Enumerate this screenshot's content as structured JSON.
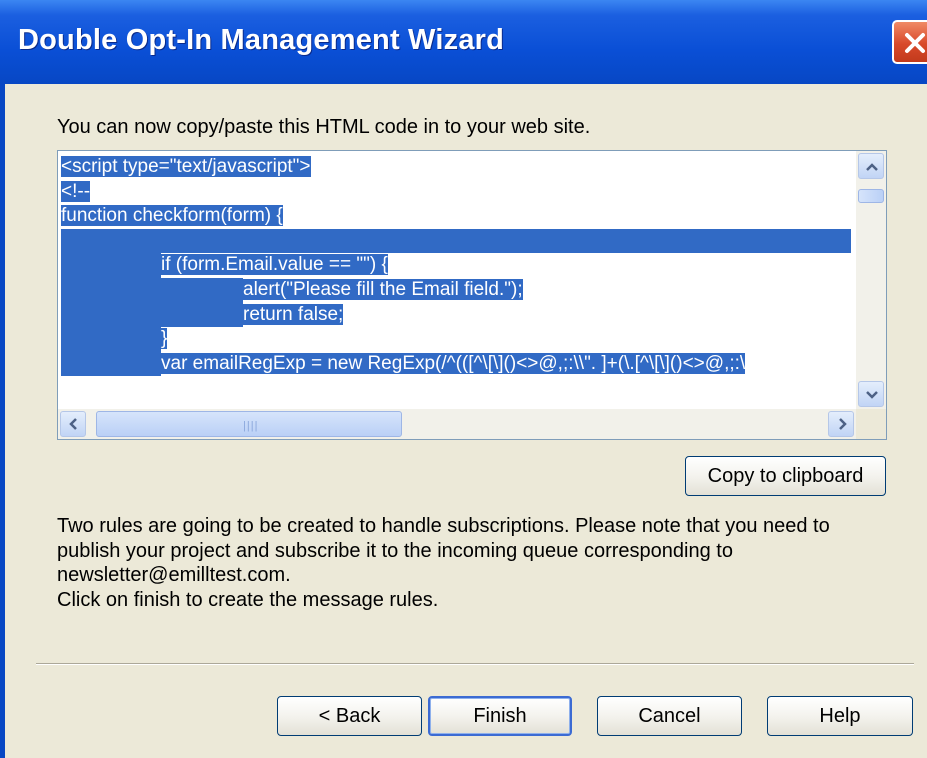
{
  "window": {
    "title": "Double Opt-In Management Wizard"
  },
  "intro_text": "You can now copy/paste this HTML code in to your web site.",
  "code_lines": [
    "<script type=\"text/javascript\">",
    "<!--",
    "function checkform(form) {",
    "",
    "if (form.Email.value == \"\") {",
    "alert(\"Please fill the Email field.\");",
    "return false;",
    "}",
    "var emailRegExp = new RegExp(/^(([^\\[\\]()<>@,;:\\\\\". ]+(\\.[^\\[\\]()<>@,;:\\"
  ],
  "copy_button_label": "Copy to clipboard",
  "rules_text": {
    "line1": "Two rules are going to be created to handle subscriptions. Please note that you need to",
    "line2": "publish your project and subscribe it to the incoming queue corresponding to",
    "line3": "newsletter@emilltest.com.",
    "line4": "Click on finish to create the message rules."
  },
  "buttons": {
    "back": "< Back",
    "finish": "Finish",
    "cancel": "Cancel",
    "help": "Help"
  },
  "colors": {
    "titlebar": "#0a4fd6",
    "selection": "#316ac5",
    "dialog_bg": "#ece9d8"
  }
}
